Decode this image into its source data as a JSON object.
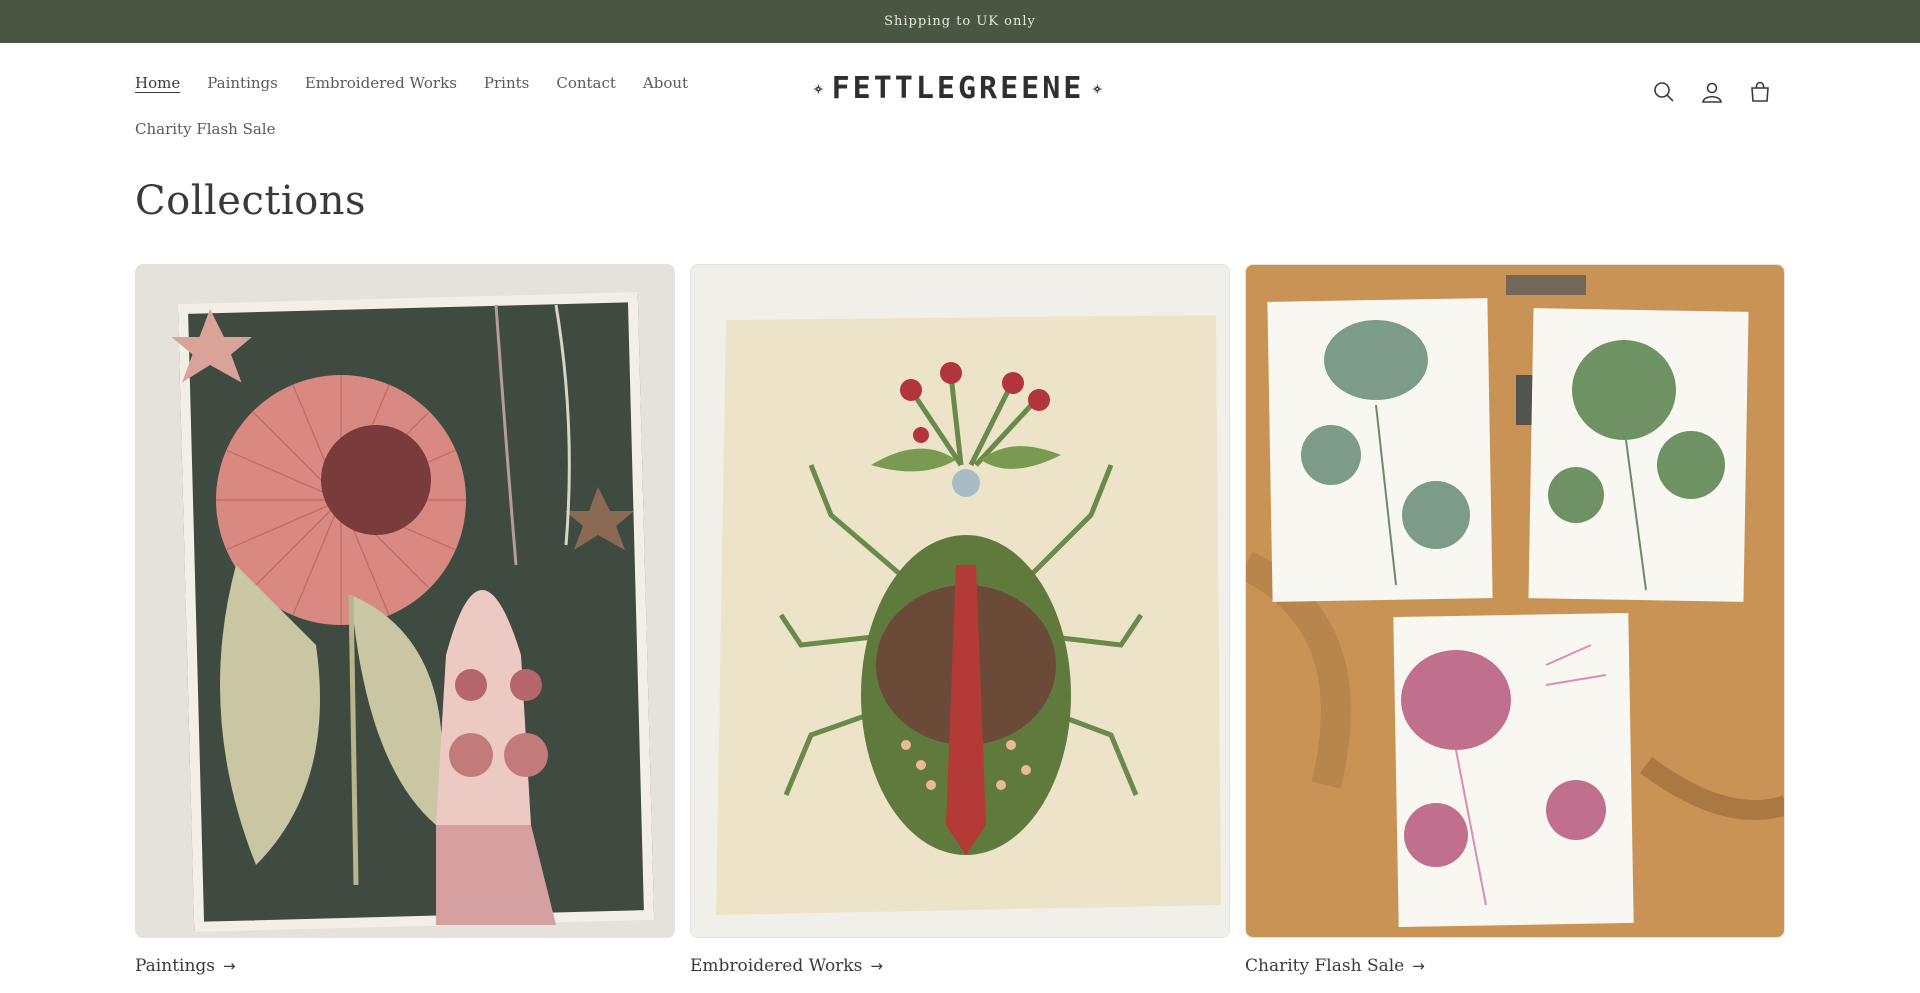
{
  "announcement": {
    "text": "Shipping to UK only"
  },
  "header": {
    "nav": [
      {
        "label": "Home",
        "active": true
      },
      {
        "label": "Paintings"
      },
      {
        "label": "Embroidered Works"
      },
      {
        "label": "Prints"
      },
      {
        "label": "Contact"
      },
      {
        "label": "About"
      },
      {
        "label": "Charity Flash Sale"
      }
    ],
    "logo_text": "FETTLEGREENE",
    "icons": [
      "search-icon",
      "account-icon",
      "cart-icon"
    ]
  },
  "page": {
    "title": "Collections"
  },
  "collections": [
    {
      "label": "Paintings",
      "arrow": "→"
    },
    {
      "label": "Embroidered Works",
      "arrow": "→"
    },
    {
      "label": "Charity Flash Sale",
      "arrow": "→"
    }
  ],
  "colors": {
    "announcement_bg": "#4a5644",
    "text": "#3a3a3a"
  }
}
